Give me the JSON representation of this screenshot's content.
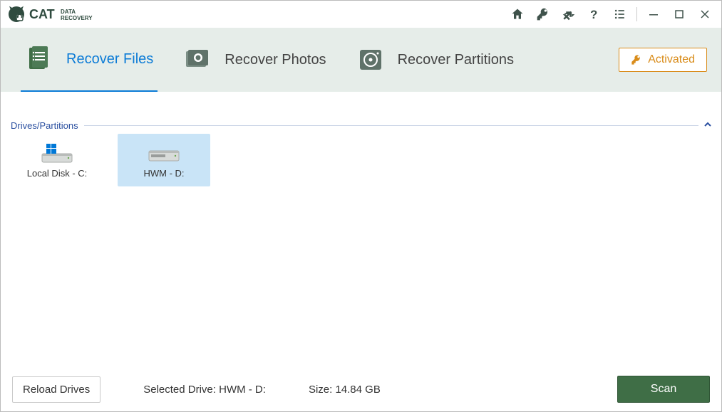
{
  "app": {
    "brand_main": "CAT",
    "brand_sub1": "DATA",
    "brand_sub2": "RECOVERY"
  },
  "tabs": {
    "recover_files": "Recover Files",
    "recover_photos": "Recover Photos",
    "recover_partitions": "Recover Partitions"
  },
  "activated_label": "Activated",
  "section": {
    "drives_label": "Drives/Partitions"
  },
  "drives": {
    "local_c": "Local Disk - C:",
    "hwm_d": "HWM - D:"
  },
  "bottom": {
    "reload": "Reload Drives",
    "selected_prefix": "Selected Drive: ",
    "selected_value": "HWM - D:",
    "size_prefix": "Size: ",
    "size_value": "14.84 GB",
    "scan": "Scan"
  }
}
